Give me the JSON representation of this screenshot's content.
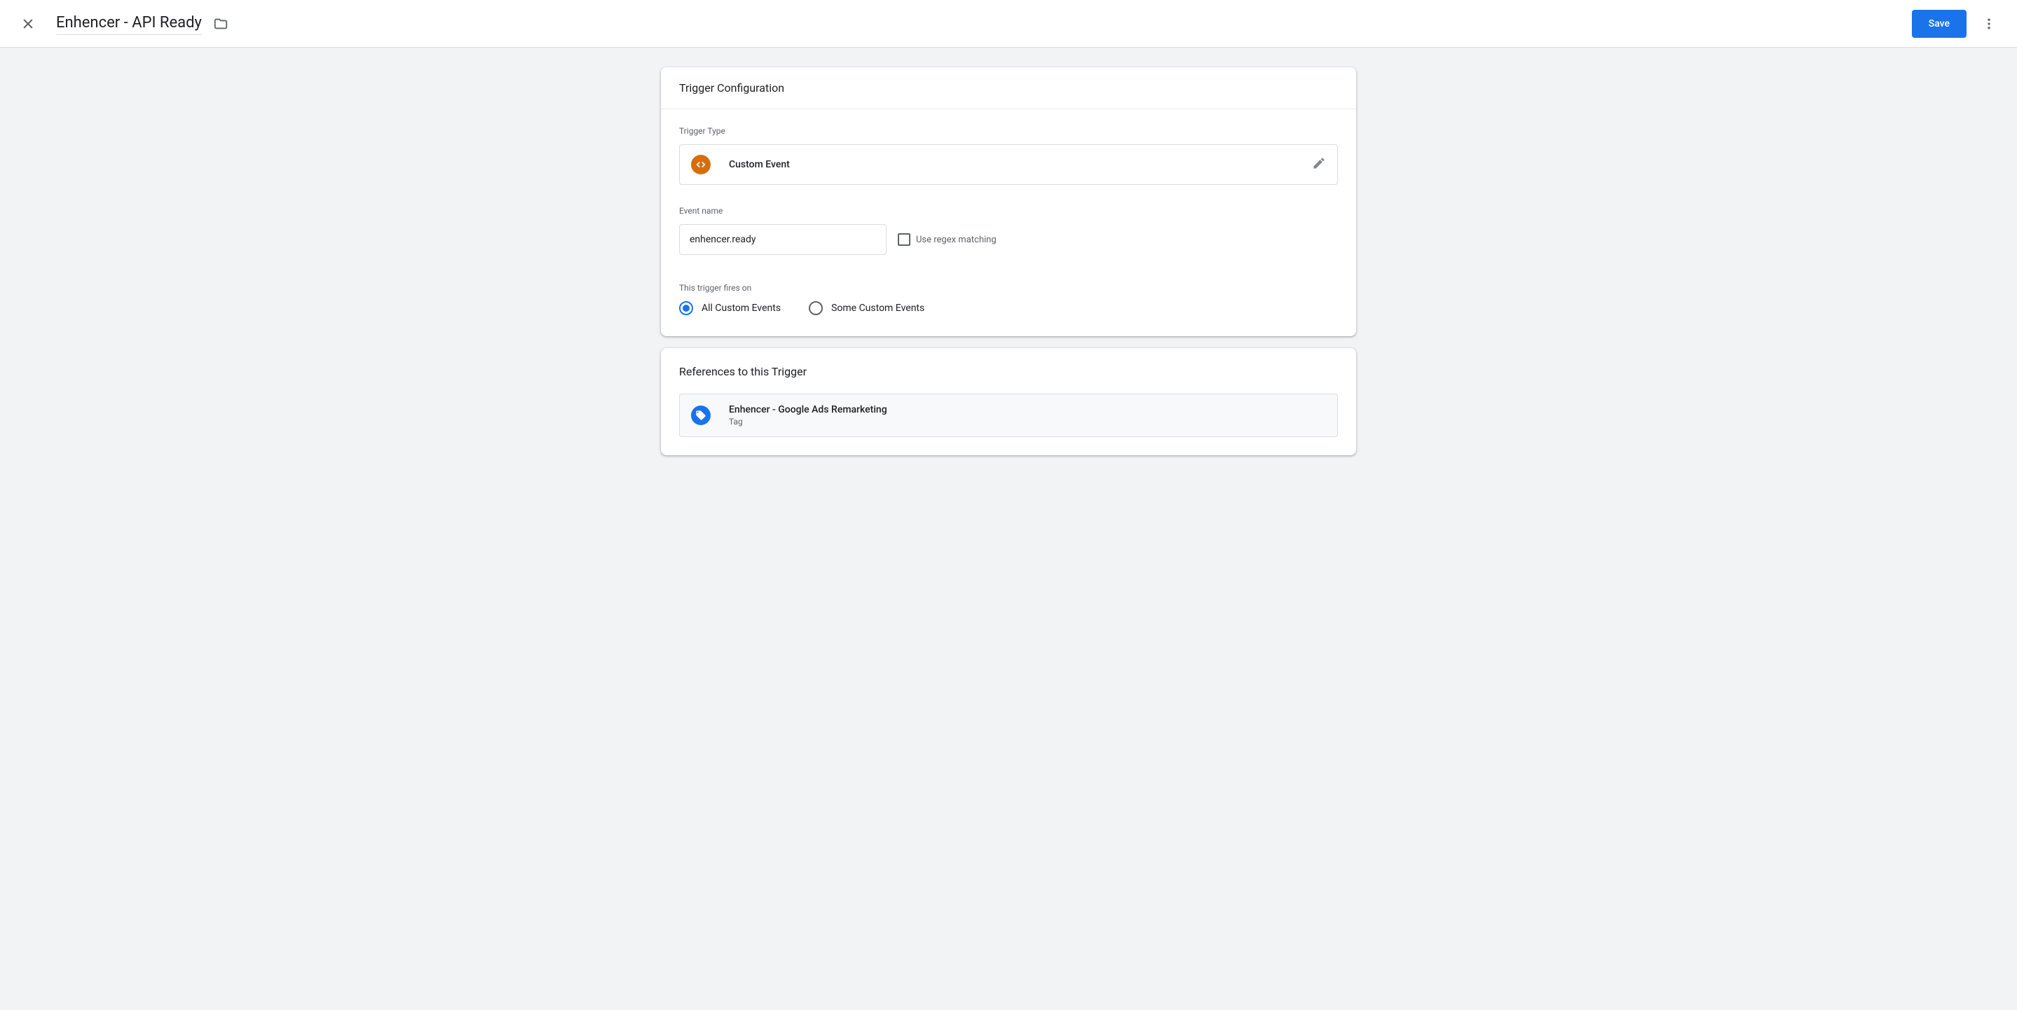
{
  "header": {
    "title": "Enhencer - API Ready",
    "save_label": "Save"
  },
  "config": {
    "card_title": "Trigger Configuration",
    "trigger_type_label": "Trigger Type",
    "trigger_type_name": "Custom Event",
    "event_name_label": "Event name",
    "event_name_value": "enhencer.ready",
    "regex_label": "Use regex matching",
    "fires_on_label": "This trigger fires on",
    "radio_all": "All Custom Events",
    "radio_some": "Some Custom Events"
  },
  "references": {
    "title": "References to this Trigger",
    "items": [
      {
        "name": "Enhencer - Google Ads Remarketing",
        "type": "Tag"
      }
    ]
  }
}
